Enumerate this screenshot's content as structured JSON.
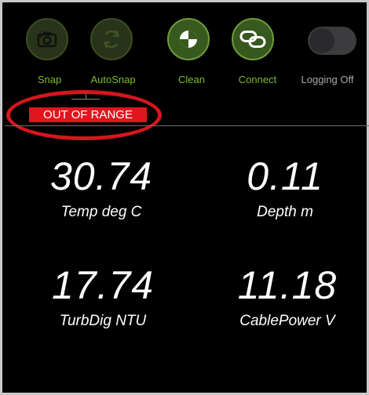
{
  "toolbar": {
    "snap": {
      "label": "Snap",
      "color": "#7dba2f",
      "icon": "camera-icon"
    },
    "autosnap": {
      "label": "AutoSnap",
      "color": "#7dba2f",
      "icon": "refresh-icon"
    },
    "clean": {
      "label": "Clean",
      "color": "#7dba2f",
      "icon": "clean-icon"
    },
    "connect": {
      "label": "Connect",
      "color": "#7dba2f",
      "icon": "link-icon"
    },
    "logging": {
      "label": "Logging Off",
      "color": "#a8a8a8",
      "state": "off"
    }
  },
  "status": {
    "out_of_range": "OUT OF RANGE",
    "color": "#e2151f"
  },
  "readings": [
    {
      "value": "30.74",
      "label": "Temp deg C"
    },
    {
      "value": "0.11",
      "label": "Depth m"
    },
    {
      "value": "17.74",
      "label": "TurbDig NTU"
    },
    {
      "value": "11.18",
      "label": "CablePower V"
    }
  ]
}
